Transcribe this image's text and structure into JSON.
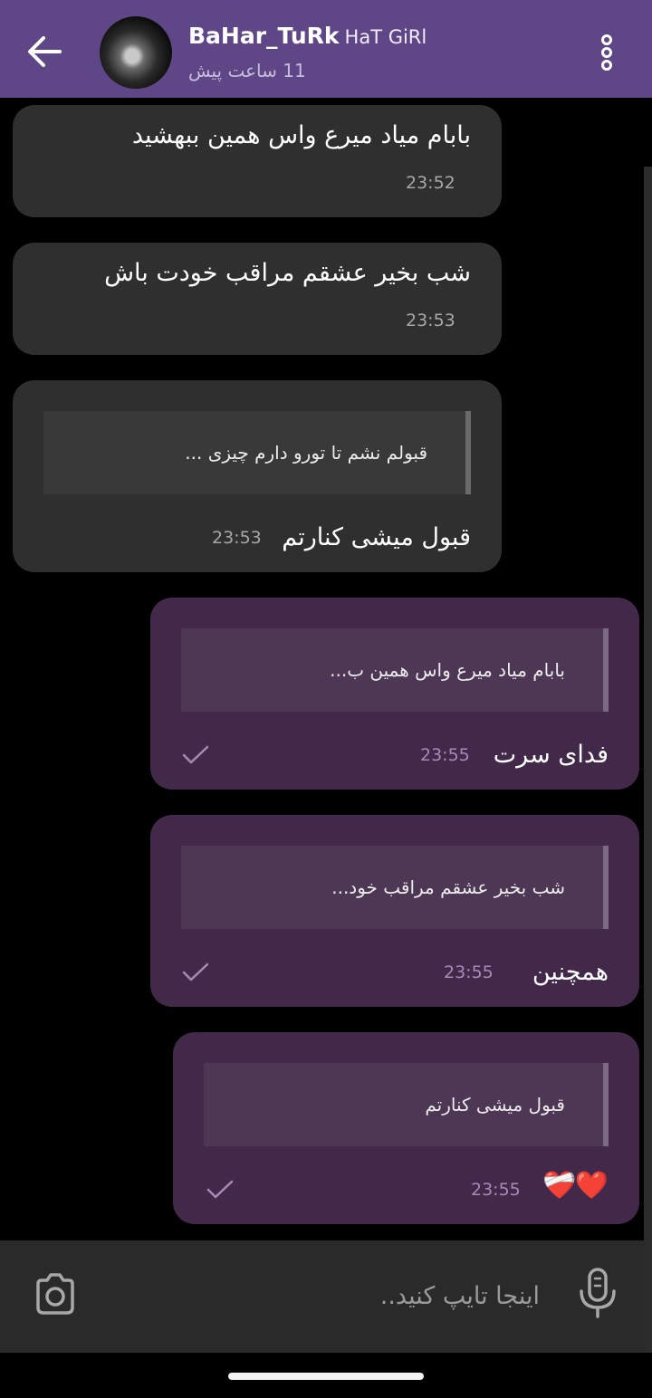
{
  "header": {
    "contact_name": "BaHar_TuRk",
    "contact_tag": "HaT GiRl",
    "last_seen": "11 ساعت پیش"
  },
  "messages": [
    {
      "direction": "incoming",
      "text": "بابام میاد میرع واس همین ببهشید",
      "time": "23:52"
    },
    {
      "direction": "incoming",
      "text": "شب بخیر عشقم مراقب خودت باش",
      "time": "23:53"
    },
    {
      "direction": "incoming",
      "quote": "قبولم نشم تا تورو دارم چیزی ...",
      "text": "قبول میشی کنارتم",
      "time": "23:53"
    },
    {
      "direction": "outgoing",
      "quote": "بابام میاد میرع واس همین ب...",
      "text": "فدای سرت",
      "time": "23:55",
      "status": "sent"
    },
    {
      "direction": "outgoing",
      "quote": "شب بخیر عشقم مراقب خود...",
      "text": "همچنین",
      "time": "23:55",
      "status": "sent"
    },
    {
      "direction": "outgoing",
      "quote": "قبول میشی کنارتم",
      "text": "❤️‍🩹❤️",
      "time": "23:55",
      "status": "sent"
    }
  ],
  "composer": {
    "placeholder": "اینجا تایپ کنید.."
  },
  "colors": {
    "header_bg": "#5f4686",
    "incoming_bubble": "#2f2f2f",
    "outgoing_bubble": "#42294a",
    "background": "#000000",
    "heart": "#e8232f"
  },
  "icons": {
    "back": "arrow-left-icon",
    "menu": "more-vertical-icon",
    "camera": "camera-icon",
    "mic": "microphone-icon",
    "status": "check-icon"
  }
}
